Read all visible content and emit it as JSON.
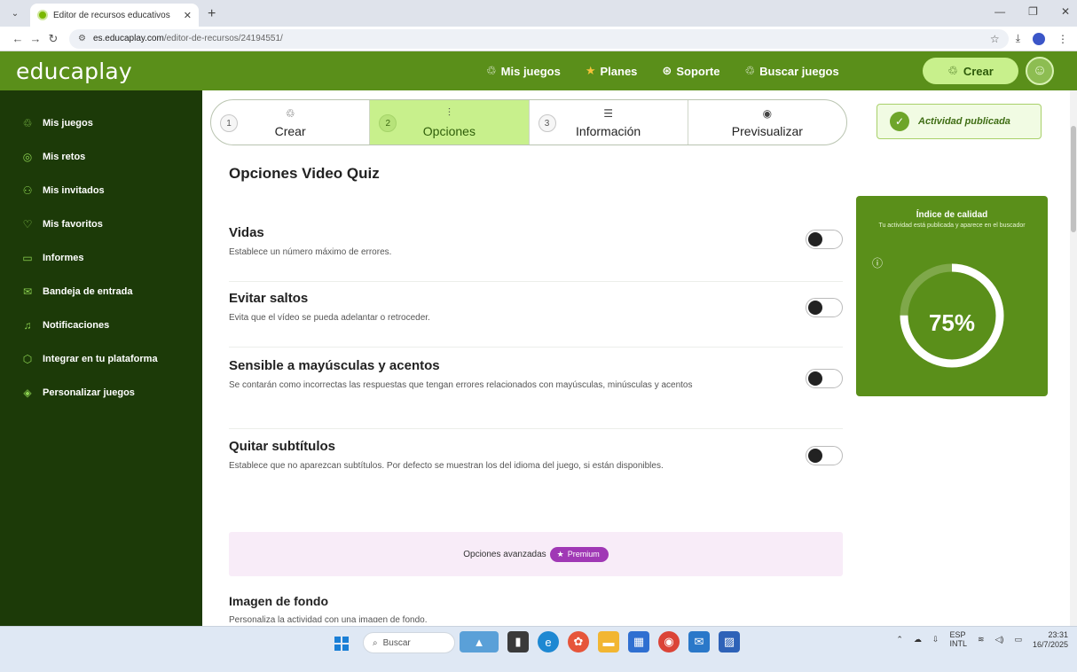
{
  "browser": {
    "tab_title": "Editor de recursos educativos",
    "url_domain": "es.educaplay.com",
    "url_path": "/editor-de-recursos/24194551/"
  },
  "header": {
    "logo": "educaplay",
    "nav": [
      {
        "label": "Mis juegos",
        "icon": "puzzle-icon"
      },
      {
        "label": "Planes",
        "icon": "star-icon"
      },
      {
        "label": "Soporte",
        "icon": "lifebuoy-icon"
      },
      {
        "label": "Buscar juegos",
        "icon": "search-puzzle-icon"
      }
    ],
    "crear_label": "Crear"
  },
  "sidebar": {
    "items": [
      {
        "label": "Mis juegos",
        "icon": "puzzle-icon"
      },
      {
        "label": "Mis retos",
        "icon": "target-icon"
      },
      {
        "label": "Mis invitados",
        "icon": "users-icon"
      },
      {
        "label": "Mis favoritos",
        "icon": "heart-icon"
      },
      {
        "label": "Informes",
        "icon": "clipboard-icon"
      },
      {
        "label": "Bandeja de entrada",
        "icon": "mail-icon"
      },
      {
        "label": "Notificaciones",
        "icon": "bell-icon"
      },
      {
        "label": "Integrar en tu plataforma",
        "icon": "cube-icon"
      },
      {
        "label": "Personalizar juegos",
        "icon": "brush-icon"
      }
    ]
  },
  "stepper": [
    {
      "num": "1",
      "label": "Crear",
      "icon": "puzzle-icon"
    },
    {
      "num": "2",
      "label": "Opciones",
      "icon": "sliders-icon"
    },
    {
      "num": "3",
      "label": "Información",
      "icon": "list-icon"
    },
    {
      "num": "",
      "label": "Previsualizar",
      "icon": "eye-icon"
    }
  ],
  "published_badge": "Actividad publicada",
  "options": {
    "title": "Opciones Video Quiz",
    "items": [
      {
        "name": "Vidas",
        "desc": "Establece un número máximo de errores.",
        "enabled": false
      },
      {
        "name": "Evitar saltos",
        "desc": "Evita que el vídeo se pueda adelantar o retroceder.",
        "enabled": false
      },
      {
        "name": "Sensible a mayúsculas y acentos",
        "desc": "Se contarán como incorrectas las respuestas que tengan errores relacionados con mayúsculas, minúsculas y acentos",
        "enabled": false
      },
      {
        "name": "Quitar subtítulos",
        "desc": "Establece que no aparezcan subtítulos. Por defecto se muestran los del idioma del juego, si están disponibles.",
        "enabled": false
      }
    ]
  },
  "quality": {
    "title": "Índice de calidad",
    "subtitle": "Tu actividad está publicada y aparece en el buscador",
    "percent_label": "75%",
    "percent_value": 0.75
  },
  "advanced": {
    "label": "Opciones avanzadas",
    "premium": "Premium"
  },
  "image_bg": {
    "title": "Imagen de fondo",
    "desc": "Personaliza la actividad con una imagen de fondo."
  },
  "taskbar": {
    "search": "Buscar",
    "lang1": "ESP",
    "lang2": "INTL",
    "time": "23:31",
    "date": "16/7/2025"
  },
  "colors": {
    "brand_green": "#5a8f1a",
    "sidebar_dark": "#1c3a08",
    "accent_light_green": "#c8f08c",
    "premium_purple": "#a038b5"
  }
}
